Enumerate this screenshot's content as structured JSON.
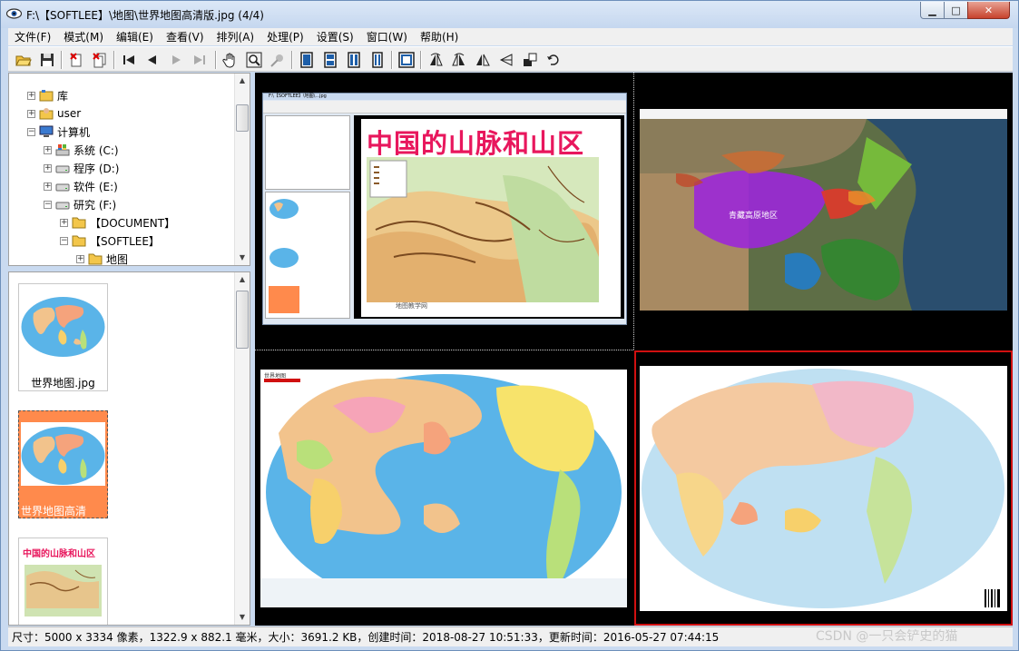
{
  "window": {
    "title": "F:\\【SOFTLEE】\\地图\\世界地图高清版.jpg (4/4)",
    "min_glyph": "▁",
    "max_glyph": "□",
    "close_glyph": "✕"
  },
  "menu": [
    "文件(F)",
    "模式(M)",
    "编辑(E)",
    "查看(V)",
    "排列(A)",
    "处理(P)",
    "设置(S)",
    "窗口(W)",
    "帮助(H)"
  ],
  "toolbar": {
    "icons": [
      "open-folder-icon",
      "save-icon",
      "delete-icon",
      "delete-multiple-icon",
      "first-icon",
      "previous-icon",
      "next-icon",
      "last-icon",
      "hand-pan-icon",
      "zoom-icon",
      "effect-icon",
      "layout-single-icon",
      "layout-split-h-icon",
      "layout-split-v-icon",
      "layout-columns-icon",
      "fit-window-icon",
      "flip-left-icon",
      "flip-right-icon",
      "mirror-icon",
      "rotate-icon",
      "crop-icon",
      "undo-icon"
    ]
  },
  "tree": {
    "items": [
      {
        "label": "库",
        "depth": 1,
        "expander": "+",
        "icon": "library-icon"
      },
      {
        "label": "user",
        "depth": 1,
        "expander": "+",
        "icon": "user-folder-icon"
      },
      {
        "label": "计算机",
        "depth": 1,
        "expander": "−",
        "icon": "computer-icon"
      },
      {
        "label": "系统 (C:)",
        "depth": 2,
        "expander": "+",
        "icon": "system-drive-icon"
      },
      {
        "label": "程序 (D:)",
        "depth": 2,
        "expander": "+",
        "icon": "drive-icon"
      },
      {
        "label": "软件 (E:)",
        "depth": 2,
        "expander": "+",
        "icon": "drive-icon"
      },
      {
        "label": "研究 (F:)",
        "depth": 2,
        "expander": "−",
        "icon": "drive-icon"
      },
      {
        "label": "【DOCUMENT】",
        "depth": 3,
        "expander": "+",
        "icon": "folder-icon"
      },
      {
        "label": "【SOFTLEE】",
        "depth": 3,
        "expander": "−",
        "icon": "folder-icon"
      },
      {
        "label": "地图",
        "depth": 4,
        "expander": "+",
        "icon": "folder-icon"
      }
    ]
  },
  "thumbnails": [
    {
      "label": "世界地图.jpg",
      "selected": false,
      "kind": "world-pacific"
    },
    {
      "label": "世界地图高清",
      "selected": true,
      "kind": "world-pacific"
    },
    {
      "label": "中国的山脉和山区",
      "selected": false,
      "kind": "china-mountains"
    }
  ],
  "viewer": {
    "screenshot_title": "F:\\【SOFTLEE】\\地图\\...jpg",
    "china_map_title": "中国的山脉和山区",
    "satellite_region": "青藏高原地区",
    "credit": "地图教学网",
    "world_legend": "世界地图"
  },
  "status": {
    "text": "尺寸：5000 x 3334 像素，1322.9 x 882.1 毫米，大小：3691.2 KB，创建时间：2018-08-27 10:51:33，更新时间：2016-05-27 07:44:15"
  },
  "watermark": "CSDN @一只会铲史的猫",
  "colors": {
    "title_pink": "#e8175d",
    "ocean": "#5ab4e8",
    "selection": "#d01010",
    "thumb_selected": "#ff8a4c"
  }
}
